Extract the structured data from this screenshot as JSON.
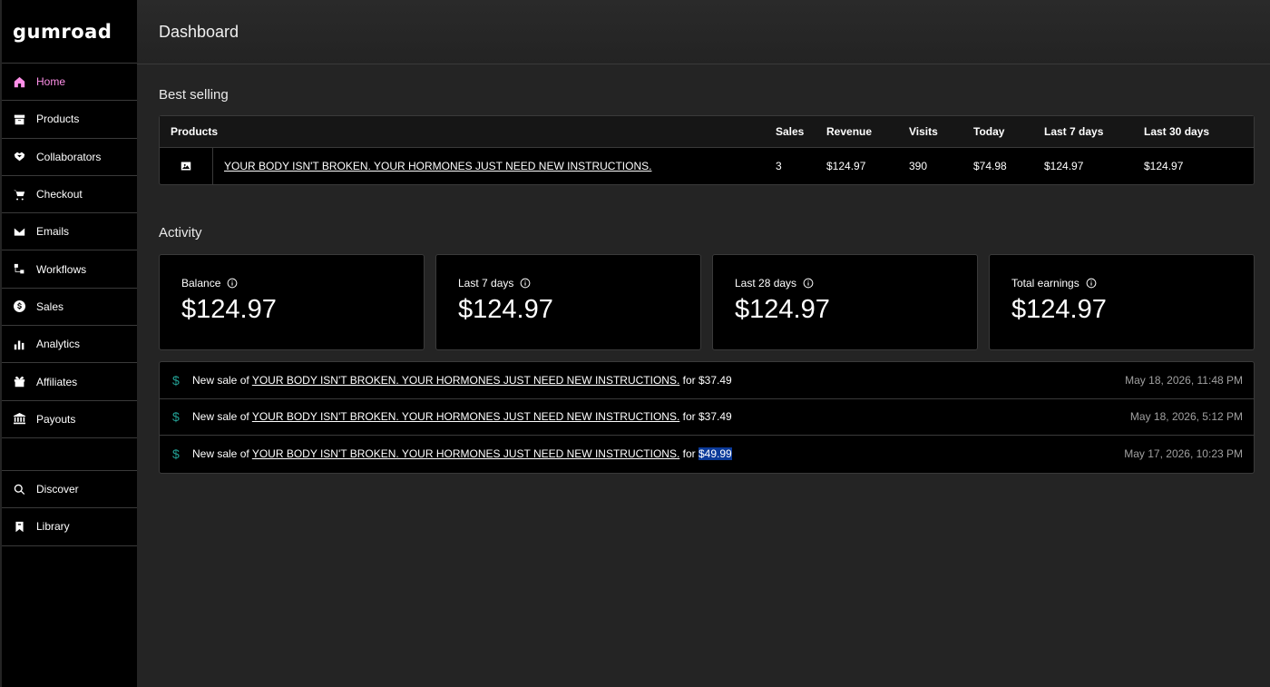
{
  "app": {
    "logo": "gumroad"
  },
  "sidebar": {
    "items": [
      {
        "label": "Home",
        "icon": "home-icon",
        "active": true
      },
      {
        "label": "Products",
        "icon": "archive-icon"
      },
      {
        "label": "Collaborators",
        "icon": "handshake-icon"
      },
      {
        "label": "Checkout",
        "icon": "cart-icon"
      },
      {
        "label": "Emails",
        "icon": "envelope-icon"
      },
      {
        "label": "Workflows",
        "icon": "workflow-icon"
      },
      {
        "label": "Sales",
        "icon": "dollar-circle-icon"
      },
      {
        "label": "Analytics",
        "icon": "bar-chart-icon"
      },
      {
        "label": "Affiliates",
        "icon": "gift-icon"
      },
      {
        "label": "Payouts",
        "icon": "bank-icon"
      }
    ],
    "bottom_items": [
      {
        "label": "Discover",
        "icon": "search-icon"
      },
      {
        "label": "Library",
        "icon": "bookmark-icon"
      }
    ]
  },
  "header": {
    "title": "Dashboard"
  },
  "best_selling": {
    "title": "Best selling",
    "columns": [
      "Products",
      "Sales",
      "Revenue",
      "Visits",
      "Today",
      "Last 7 days",
      "Last 30 days"
    ],
    "rows": [
      {
        "product": "YOUR BODY ISN'T BROKEN. YOUR HORMONES JUST NEED NEW INSTRUCTIONS.",
        "sales": "3",
        "revenue": "$124.97",
        "visits": "390",
        "today": "$74.98",
        "last7": "$124.97",
        "last30": "$124.97"
      }
    ]
  },
  "activity": {
    "title": "Activity",
    "cards": [
      {
        "label": "Balance",
        "value": "$124.97"
      },
      {
        "label": "Last 7 days",
        "value": "$124.97"
      },
      {
        "label": "Last 28 days",
        "value": "$124.97"
      },
      {
        "label": "Total earnings",
        "value": "$124.97"
      }
    ],
    "feed": [
      {
        "prefix": "New sale of",
        "product": "YOUR BODY ISN'T BROKEN. YOUR HORMONES JUST NEED NEW INSTRUCTIONS.",
        "for": "for",
        "amount": "$37.49",
        "date": "May 18, 2026, 11:48 PM"
      },
      {
        "prefix": "New sale of",
        "product": "YOUR BODY ISN'T BROKEN. YOUR HORMONES JUST NEED NEW INSTRUCTIONS.",
        "for": "for",
        "amount": "$37.49",
        "date": "May 18, 2026, 5:12 PM"
      },
      {
        "prefix": "New sale of",
        "product": "YOUR BODY ISN'T BROKEN. YOUR HORMONES JUST NEED NEW INSTRUCTIONS.",
        "for": "for",
        "amount": "$49.99",
        "date": "May 17, 2026, 10:23 PM",
        "highlighted": true
      }
    ]
  },
  "colors": {
    "accent": "#ff90e8",
    "dollar": "#23a094",
    "selection": "#0b3a9a"
  }
}
